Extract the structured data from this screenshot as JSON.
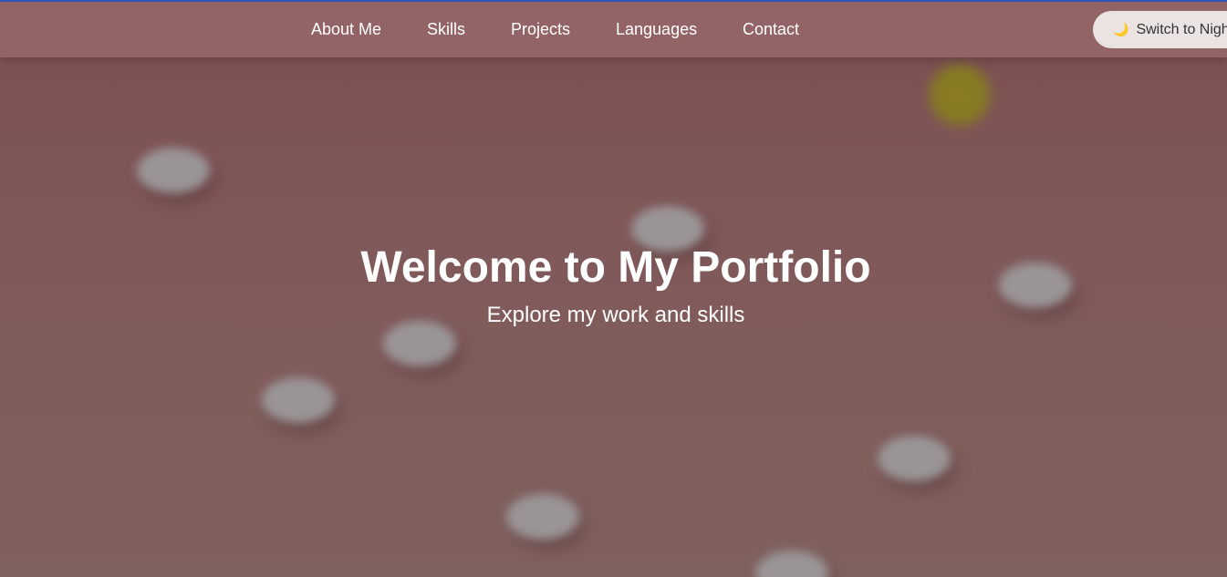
{
  "nav": {
    "items": [
      {
        "label": "About Me"
      },
      {
        "label": "Skills"
      },
      {
        "label": "Projects"
      },
      {
        "label": "Languages"
      },
      {
        "label": "Contact"
      }
    ],
    "theme_toggle": {
      "icon": "crescent-moon-icon",
      "icon_glyph": "🌙",
      "label": "Switch to Night Mode"
    }
  },
  "hero": {
    "title": "Welcome to My Portfolio",
    "subtitle": "Explore my work and skills"
  },
  "colors": {
    "navbar_bg": "#926466",
    "hero_bg": "#805a5a",
    "top_line": "#2f56b8",
    "toggle_bg": "#ebe2e2",
    "sun": "#857a25",
    "cloud": "#9a9497",
    "text": "#ffffff"
  }
}
